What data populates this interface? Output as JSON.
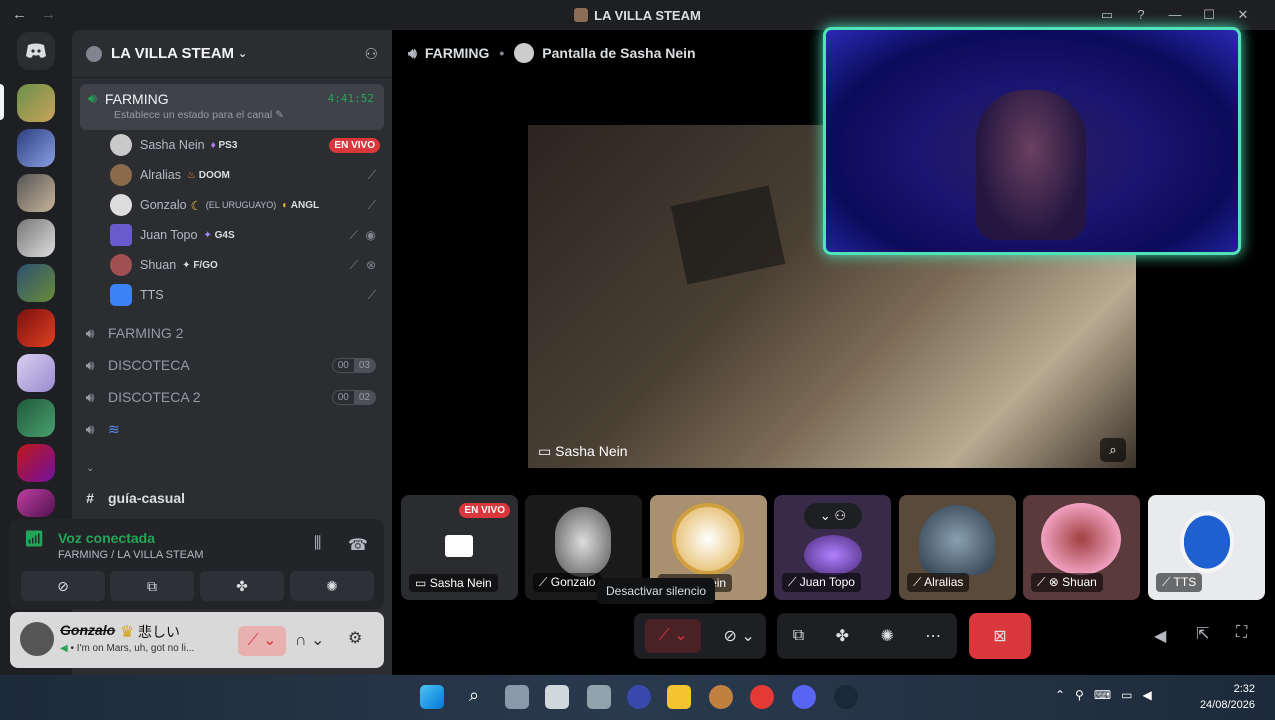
{
  "window": {
    "title": "LA VILLA STEAM",
    "back": "←",
    "forward": "→"
  },
  "sidebar": {
    "guild_name": "LA VILLA STEAM",
    "active_channel": {
      "name": "FARMING",
      "timer": "4:41:52",
      "status_hint": "Establece un estado para el canal"
    },
    "members": [
      {
        "name": "Sasha Nein",
        "tag": "PS3",
        "badge": "EN VIVO"
      },
      {
        "name": "Alralias",
        "tag": "DOOM"
      },
      {
        "name": "Gonzalo",
        "extra": "(EL URUGUAYO)",
        "tag": "ANGL"
      },
      {
        "name": "Juan Topo",
        "tag": "G4S"
      },
      {
        "name": "Shuan",
        "tag": "F/GO"
      },
      {
        "name": "TTS"
      }
    ],
    "channels": [
      {
        "name": "FARMING 2"
      },
      {
        "name": "DISCOTECA",
        "count_a": "00",
        "count_b": "03"
      },
      {
        "name": "DISCOTECA 2",
        "count_a": "00",
        "count_b": "02"
      },
      {
        "name": ""
      }
    ],
    "text_channel": "guía-casual"
  },
  "voice_panel": {
    "status": "Voz conectada",
    "location": "FARMING / LA VILLA STEAM"
  },
  "user_panel": {
    "username": "Gonzalo",
    "nickname": "悲しい",
    "custom_status": "I'm on Mars, uh, got no li..."
  },
  "stage": {
    "channel": "FARMING",
    "screen_title": "Pantalla de Sasha Nein",
    "stream_owner": "Sasha Nein",
    "tiles": [
      {
        "name": "Sasha Nein",
        "badge": "EN VIVO"
      },
      {
        "name": "Gonzalo"
      },
      {
        "name": "Sasha Nein"
      },
      {
        "name": "Juan Topo"
      },
      {
        "name": "Alralias"
      },
      {
        "name": "Shuan"
      },
      {
        "name": "TTS"
      }
    ],
    "tooltip": "Desactivar silencio"
  },
  "taskbar": {
    "time": "2:32",
    "date": "24/08/2026"
  },
  "colors": {
    "accent_green": "#23a559",
    "live_red": "#da373c",
    "cam_border": "#4fe3b8",
    "hangup": "#da373c"
  }
}
